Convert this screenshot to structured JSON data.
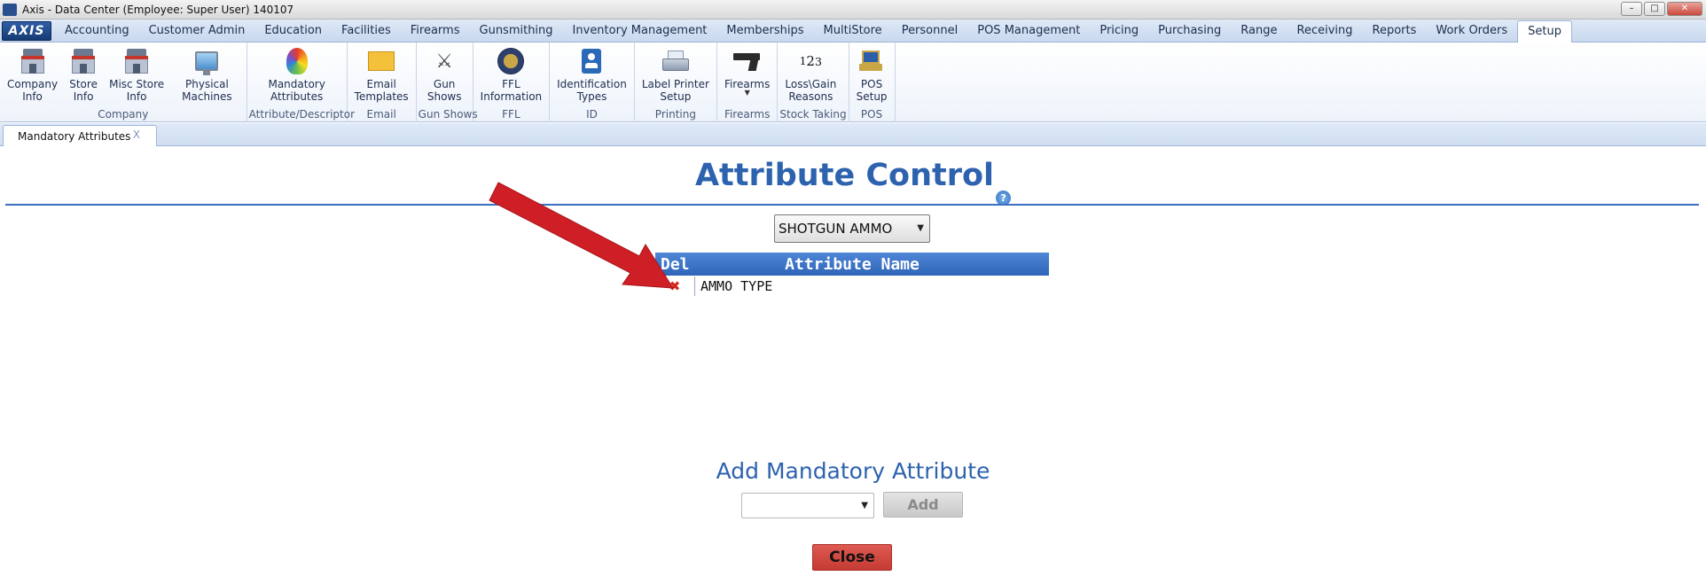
{
  "window": {
    "title": "Axis - Data Center  (Employee: Super User) 140107",
    "controls": {
      "minimize": "–",
      "maximize": "□",
      "close": "✕"
    }
  },
  "menu": {
    "logo": "AXIS",
    "tabs": [
      {
        "label": "Accounting"
      },
      {
        "label": "Customer Admin"
      },
      {
        "label": "Education"
      },
      {
        "label": "Facilities"
      },
      {
        "label": "Firearms"
      },
      {
        "label": "Gunsmithing"
      },
      {
        "label": "Inventory Management"
      },
      {
        "label": "Memberships"
      },
      {
        "label": "MultiStore"
      },
      {
        "label": "Personnel"
      },
      {
        "label": "POS Management"
      },
      {
        "label": "Pricing"
      },
      {
        "label": "Purchasing"
      },
      {
        "label": "Range"
      },
      {
        "label": "Receiving"
      },
      {
        "label": "Reports"
      },
      {
        "label": "Work Orders"
      },
      {
        "label": "Setup"
      }
    ],
    "active_tab": "Setup"
  },
  "ribbon": {
    "groups": {
      "company": {
        "label": "Company",
        "items": [
          "Company\nInfo",
          "Store\nInfo",
          "Misc Store\nInfo",
          "Physical\nMachines"
        ]
      },
      "attribute": {
        "label": "Attribute/Descriptor",
        "items": [
          "Mandatory\nAttributes"
        ]
      },
      "email": {
        "label": "Email",
        "items": [
          "Email\nTemplates"
        ]
      },
      "gunshows": {
        "label": "Gun Shows",
        "items": [
          "Gun\nShows"
        ]
      },
      "ffl": {
        "label": "FFL",
        "items": [
          "FFL\nInformation"
        ]
      },
      "id": {
        "label": "ID",
        "items": [
          "Identification\nTypes"
        ]
      },
      "printing": {
        "label": "Printing",
        "items": [
          "Label Printer\nSetup"
        ]
      },
      "firearms": {
        "label": "Firearms",
        "items": [
          "Firearms"
        ]
      },
      "stocktaking": {
        "label": "Stock Taking",
        "items": [
          "Loss\\Gain\nReasons"
        ]
      },
      "pos": {
        "label": "POS",
        "items": [
          "POS\nSetup"
        ]
      }
    },
    "icon_names": [
      "building-icon",
      "store-icon",
      "misc-store-icon",
      "monitor-icon",
      "rainbow-feather-icon",
      "envelope-icon",
      "crossed-guns-icon",
      "seal-icon",
      "id-badge-icon",
      "printer-icon",
      "pistol-icon",
      "numbers-icon",
      "pos-terminal-icon"
    ]
  },
  "doc_tab": {
    "label": "Mandatory Attributes",
    "close": "X"
  },
  "main": {
    "title": "Attribute Control",
    "help": "?",
    "category": {
      "selected": "SHOTGUN AMMO"
    },
    "grid": {
      "columns": {
        "del": "Del",
        "name": "Attribute Name"
      },
      "rows": [
        {
          "name": "AMMO TYPE"
        }
      ]
    },
    "add_section": {
      "title": "Add Mandatory Attribute",
      "select_value": "",
      "add_label": "Add"
    },
    "close_label": "Close"
  },
  "colors": {
    "accent": "#2d62ae",
    "grid_header": "#3a70c3",
    "close_button": "#d44b43",
    "annotation_arrow": "#cf1f26"
  }
}
